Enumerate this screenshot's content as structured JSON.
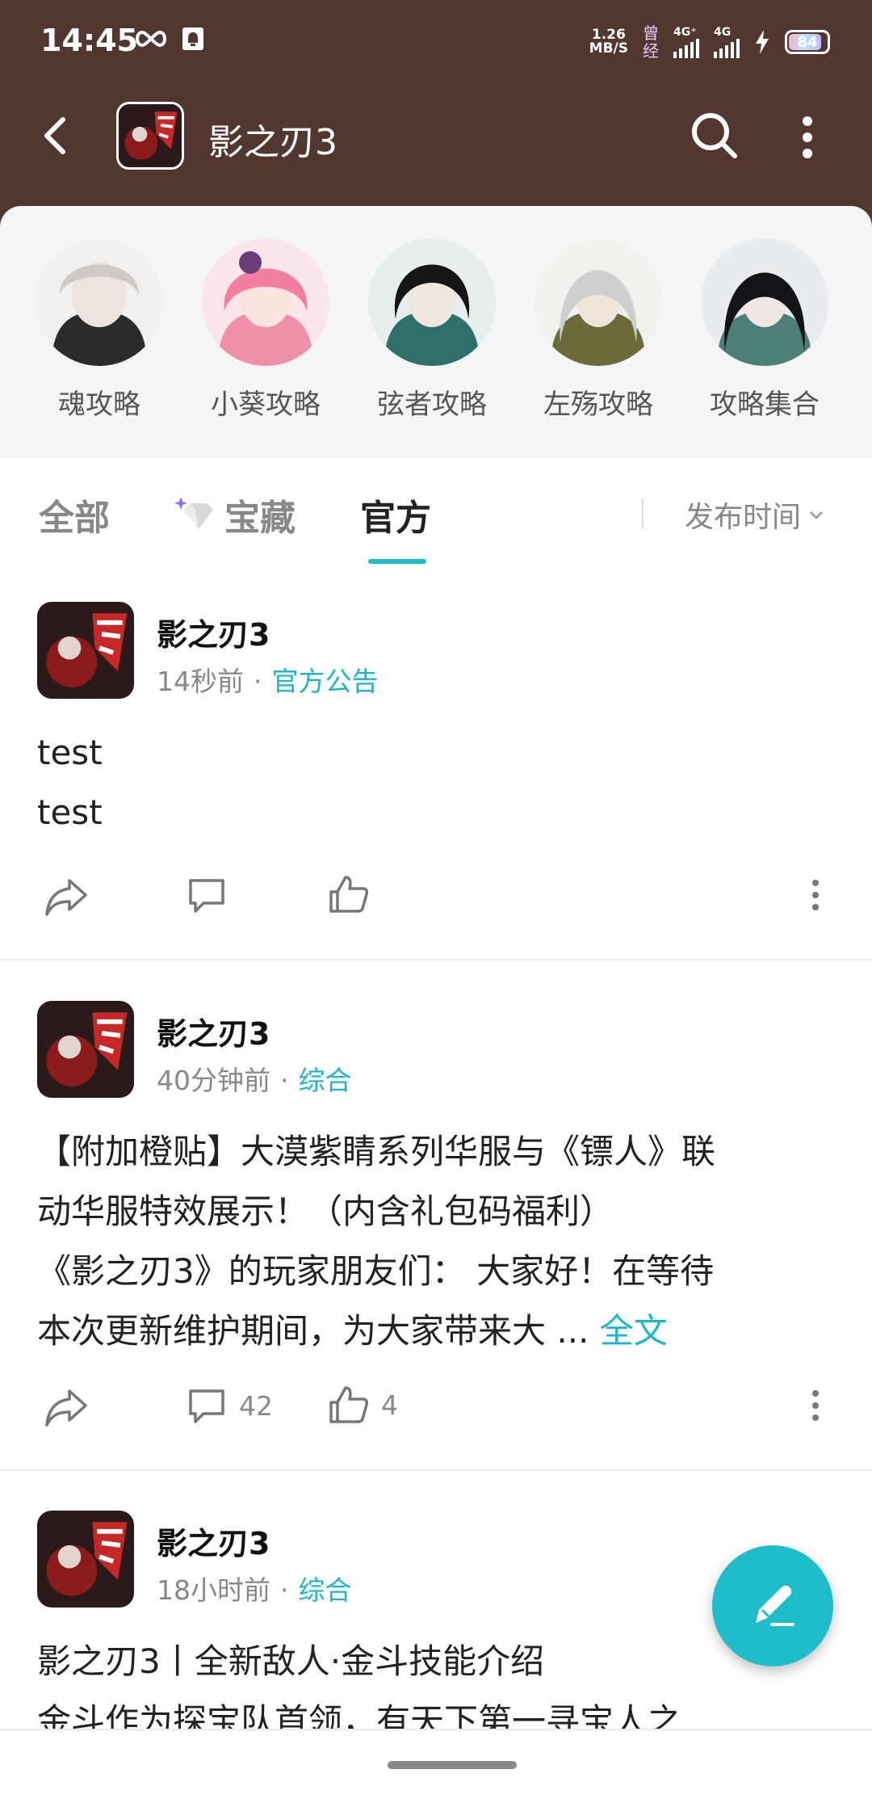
{
  "status_bar": {
    "time": "14:45",
    "net_speed_value": "1.26",
    "net_speed_unit": "MB/S",
    "carrier_top": "曾",
    "carrier_bottom": "经",
    "signal1_label": "4G⁺",
    "signal2_label": "4G",
    "battery_level": "84"
  },
  "topbar": {
    "title": "影之刃3"
  },
  "guides": [
    {
      "label": "魂攻略",
      "color": "#e9e6e4"
    },
    {
      "label": "小葵攻略",
      "color": "#f2b6c5"
    },
    {
      "label": "弦者攻略",
      "color": "#5a6d6b"
    },
    {
      "label": "左殇攻略",
      "color": "#d9d6cf"
    },
    {
      "label": "攻略集合",
      "color": "#3d3b43"
    }
  ],
  "tabs": {
    "all": "全部",
    "treasure": "宝藏",
    "official": "官方",
    "sort": "发布时间"
  },
  "posts": [
    {
      "author": "影之刃3",
      "time": "14秒前",
      "category": "官方公告",
      "line1": "test",
      "line2": "test",
      "comments": "",
      "likes": ""
    },
    {
      "author": "影之刃3",
      "time": "40分钟前",
      "category": "综合",
      "line1": "【附加橙贴】大漠紫睛系列华服与《镖人》联",
      "line2": "动华服特效展示！（内含礼包码福利）",
      "line3": "《影之刃3》的玩家朋友们： 大家好！在等待",
      "line4": "本次更新维护期间，为大家带来大 ...",
      "readmore": "全文",
      "comments": "42",
      "likes": "4"
    },
    {
      "author": "影之刃3",
      "time": "18小时前",
      "category": "综合",
      "line1": "影之刃3丨全新敌人·金斗技能介绍",
      "line2": "金斗作为探宝队首领，有天下第一寻宝人之"
    }
  ],
  "colors": {
    "header": "#523731",
    "accent": "#1fbcc9"
  }
}
